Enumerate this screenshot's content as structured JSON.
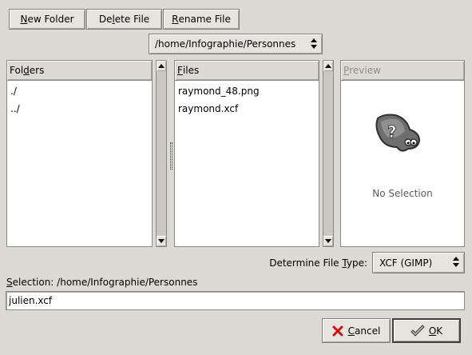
{
  "toolbar": {
    "new_folder": {
      "mn": "N",
      "rest": "ew Folder"
    },
    "delete_file": {
      "pre": "De",
      "mn": "l",
      "rest": "ete File"
    },
    "rename_file": {
      "mn": "R",
      "rest": "ename File"
    }
  },
  "path_combo": "/home/Infographie/Personnes",
  "folders": {
    "header": {
      "pre": "Fol",
      "mn": "d",
      "rest": "ers"
    },
    "items": [
      "./",
      "../"
    ]
  },
  "files": {
    "header": {
      "mn": "F",
      "rest": "iles"
    },
    "items": [
      "raymond_48.png",
      "raymond.xcf"
    ]
  },
  "preview": {
    "header": {
      "mn": "P",
      "rest": "review"
    },
    "status": "No Selection"
  },
  "file_type": {
    "label": {
      "pre": "Determine File ",
      "mn": "T",
      "rest": "ype:"
    },
    "value": "XCF (GIMP)"
  },
  "selection": {
    "label": {
      "mn": "S",
      "rest": "election: /home/Infographie/Personnes"
    },
    "value": "julien.xcf"
  },
  "buttons": {
    "cancel": {
      "mn": "C",
      "rest": "ancel"
    },
    "ok": {
      "mn": "O",
      "rest": "K"
    }
  },
  "colors": {
    "background": "#dcdad5",
    "cancel_icon": "#d01010"
  }
}
